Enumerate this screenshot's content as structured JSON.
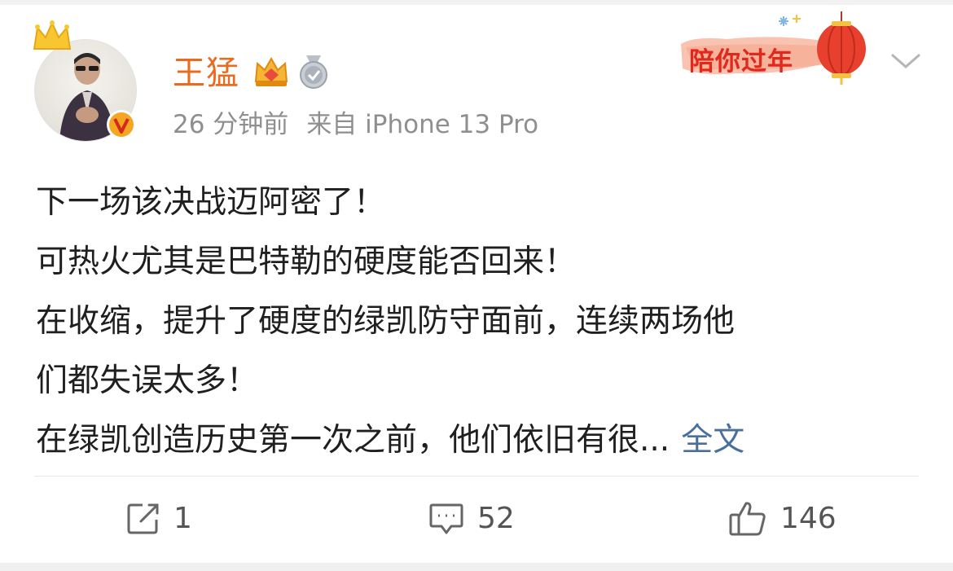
{
  "post": {
    "username": "王猛",
    "time": "26 分钟前",
    "source": "来自 iPhone 13 Pro",
    "banner_text": "陪你过年",
    "lines": [
      "下一场该决战迈阿密了！",
      "可热火尤其是巴特勒的硬度能否回来！",
      "在收缩，提升了硬度的绿凯防守面前，连续两场他",
      "们都失误太多！",
      "在绿凯创造历史第一次之前，他们依旧有很..."
    ],
    "more_label": "全文"
  },
  "actions": {
    "repost_count": "1",
    "comment_count": "52",
    "like_count": "146"
  },
  "icons": {
    "crown": "crown-icon",
    "verified": "verified-v-icon",
    "vip": "vip-crown-icon",
    "medal": "medal-icon",
    "chevron": "chevron-down-icon",
    "repost": "repost-icon",
    "comment": "comment-icon",
    "like": "like-thumb-icon"
  },
  "colors": {
    "username": "#e86b1f",
    "link": "#4a6f9c",
    "meta": "#8f8f8f",
    "banner": "#e0281c"
  }
}
